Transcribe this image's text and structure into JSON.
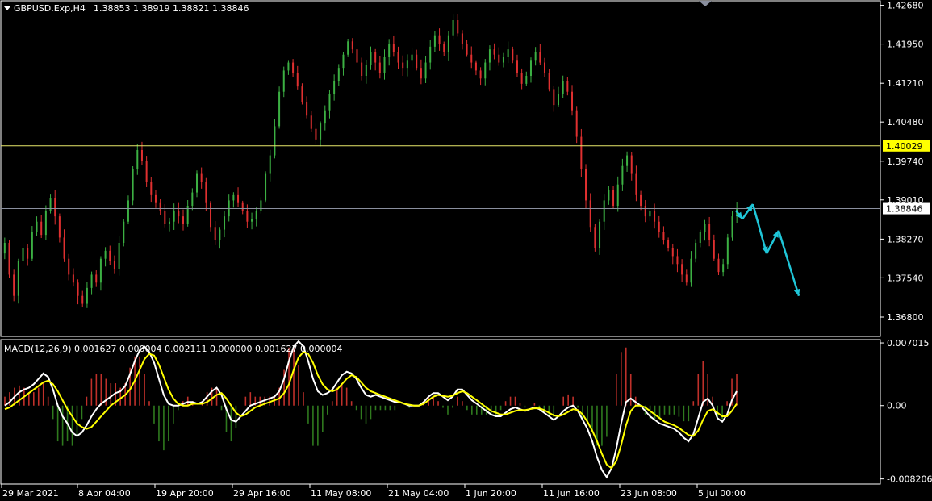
{
  "header": {
    "symbol": "GBPUSD.Exp,H4",
    "ohlc": "1.38853 1.38919 1.38821 1.38846"
  },
  "macd_header": "MACD(12,26,9) 0.001627 0.000004 0.002111 0.000000 0.001627 0.000004",
  "colors": {
    "background": "#000000",
    "frame": "#ffffff",
    "bull_candle": "#3cb043",
    "bear_candle": "#e03030",
    "level_line": "#e8e86a",
    "current_line": "#8a8f9e",
    "level_tag_bg": "#ffff00",
    "forecast_arrow": "#1fc6d8",
    "macd_line": "#ffffff",
    "signal_line": "#ffff00",
    "hist_pos": "#c0302a",
    "hist_neg": "#2f7a1e"
  },
  "chart_data": [
    {
      "type": "candlestick",
      "title": "GBPUSD.Exp,H4",
      "ylim": [
        1.3645,
        1.4275
      ],
      "y_ticks": [
        "1.42680",
        "1.41950",
        "1.41210",
        "1.40480",
        "1.39740",
        "1.39010",
        "1.38270",
        "1.37540",
        "1.36800"
      ],
      "tick_values": [
        1.4268,
        1.4195,
        1.4121,
        1.4048,
        1.3974,
        1.3901,
        1.3827,
        1.3754,
        1.368
      ],
      "level_line": {
        "value": 1.40029,
        "label": "1.40029"
      },
      "current_price": {
        "value": 1.38846,
        "label": "1.38846"
      },
      "closes": [
        1.382,
        1.376,
        1.372,
        1.3785,
        1.381,
        1.379,
        1.384,
        1.386,
        1.3835,
        1.388,
        1.3905,
        1.387,
        1.383,
        1.379,
        1.376,
        1.3745,
        1.372,
        1.3705,
        1.3735,
        1.376,
        1.3745,
        1.379,
        1.3805,
        1.3785,
        1.377,
        1.382,
        1.386,
        1.39,
        1.396,
        1.3995,
        1.3975,
        1.3935,
        1.391,
        1.3895,
        1.388,
        1.3855,
        1.386,
        1.388,
        1.387,
        1.3855,
        1.389,
        1.3915,
        1.395,
        1.3935,
        1.3895,
        1.385,
        1.3825,
        1.3845,
        1.387,
        1.39,
        1.391,
        1.3895,
        1.388,
        1.386,
        1.3865,
        1.388,
        1.39,
        1.395,
        1.3985,
        1.404,
        1.4105,
        1.4145,
        1.416,
        1.414,
        1.4115,
        1.4085,
        1.406,
        1.4035,
        1.4015,
        1.4045,
        1.407,
        1.41,
        1.4125,
        1.415,
        1.4175,
        1.42,
        1.4185,
        1.416,
        1.4135,
        1.4155,
        1.418,
        1.416,
        1.414,
        1.417,
        1.4195,
        1.418,
        1.416,
        1.415,
        1.4165,
        1.4175,
        1.415,
        1.413,
        1.416,
        1.419,
        1.421,
        1.4195,
        1.418,
        1.421,
        1.424,
        1.4215,
        1.4195,
        1.4175,
        1.416,
        1.4145,
        1.413,
        1.416,
        1.4185,
        1.4175,
        1.416,
        1.417,
        1.4185,
        1.4165,
        1.414,
        1.412,
        1.4135,
        1.4165,
        1.418,
        1.416,
        1.414,
        1.411,
        1.408,
        1.41,
        1.4125,
        1.4105,
        1.407,
        1.402,
        1.396,
        1.39,
        1.385,
        1.381,
        1.386,
        1.39,
        1.392,
        1.389,
        1.393,
        1.3965,
        1.3985,
        1.395,
        1.391,
        1.389,
        1.387,
        1.388,
        1.386,
        1.384,
        1.3825,
        1.381,
        1.3795,
        1.378,
        1.376,
        1.3745,
        1.379,
        1.382,
        1.384,
        1.3855,
        1.3825,
        1.379,
        1.3765,
        1.378,
        1.383,
        1.387,
        1.3885
      ],
      "forecast": {
        "points": [
          [
            1.3881,
            1.388
          ],
          [
            1.3865,
            1.3868
          ],
          [
            1.3893,
            1.3894
          ],
          [
            1.38,
            1.3799
          ],
          [
            1.3843,
            1.3843
          ],
          [
            1.372,
            1.372
          ]
        ]
      }
    },
    {
      "type": "macd",
      "title": "MACD(12,26,9)",
      "ylim": [
        -0.0086,
        0.0072
      ],
      "y_ticks": [
        "0.007015",
        "0.00",
        "-0.008206"
      ],
      "tick_values": [
        0.007015,
        0.0,
        -0.008206
      ],
      "macd_values": [
        0.0,
        0.0004,
        0.001,
        0.0015,
        0.0018,
        0.002,
        0.0024,
        0.003,
        0.0036,
        0.0032,
        0.0018,
        0.0,
        -0.0012,
        -0.002,
        -0.003,
        -0.0034,
        -0.003,
        -0.0022,
        -0.0012,
        -0.0004,
        0.0002,
        0.0006,
        0.001,
        0.0014,
        0.0016,
        0.0022,
        0.0035,
        0.005,
        0.0062,
        0.0066,
        0.006,
        0.0048,
        0.003,
        0.0012,
        0.0002,
        0.0,
        0.0,
        0.0002,
        0.0004,
        0.0004,
        0.0002,
        0.0004,
        0.001,
        0.0016,
        0.002,
        0.0012,
        -0.0004,
        -0.0016,
        -0.0018,
        -0.0012,
        -0.0006,
        0.0,
        0.0002,
        0.0004,
        0.0006,
        0.0008,
        0.001,
        0.0016,
        0.003,
        0.005,
        0.0066,
        0.0072,
        0.0066,
        0.005,
        0.003,
        0.0016,
        0.0012,
        0.0014,
        0.0018,
        0.0026,
        0.0034,
        0.0038,
        0.0036,
        0.003,
        0.002,
        0.0012,
        0.001,
        0.0012,
        0.001,
        0.0008,
        0.0006,
        0.0004,
        0.0004,
        0.0002,
        0.0,
        0.0,
        0.0,
        0.0004,
        0.001,
        0.0014,
        0.0014,
        0.001,
        0.0006,
        0.001,
        0.0018,
        0.0018,
        0.0012,
        0.0006,
        0.0002,
        -0.0002,
        -0.0006,
        -0.001,
        -0.0012,
        -0.0012,
        -0.0008,
        -0.0004,
        -0.0002,
        -0.0004,
        -0.0006,
        -0.0004,
        -0.0002,
        -0.0004,
        -0.0008,
        -0.0012,
        -0.0016,
        -0.0012,
        -0.0006,
        -0.0002,
        0.0,
        -0.0006,
        -0.0016,
        -0.0026,
        -0.004,
        -0.0058,
        -0.0072,
        -0.008,
        -0.007,
        -0.0048,
        -0.002,
        0.0004,
        0.0008,
        0.0004,
        0.0,
        -0.0006,
        -0.0012,
        -0.0016,
        -0.002,
        -0.0022,
        -0.0024,
        -0.0026,
        -0.003,
        -0.0036,
        -0.004,
        -0.0032,
        -0.0014,
        0.0004,
        0.0008,
        0.0,
        -0.0014,
        -0.0018,
        -0.001,
        0.0006,
        0.0016
      ],
      "signal_values": [
        -0.0004,
        -0.0002,
        0.0002,
        0.0006,
        0.001,
        0.0014,
        0.0018,
        0.0022,
        0.0026,
        0.0028,
        0.0024,
        0.0016,
        0.0006,
        -0.0004,
        -0.0012,
        -0.002,
        -0.0024,
        -0.0026,
        -0.0024,
        -0.0018,
        -0.0012,
        -0.0006,
        0.0,
        0.0004,
        0.0008,
        0.0012,
        0.0018,
        0.0028,
        0.004,
        0.0052,
        0.0058,
        0.0056,
        0.0046,
        0.0032,
        0.0018,
        0.0008,
        0.0002,
        0.0,
        0.0,
        0.0002,
        0.0002,
        0.0002,
        0.0004,
        0.0008,
        0.0012,
        0.0014,
        0.0008,
        0.0,
        -0.0008,
        -0.0012,
        -0.001,
        -0.0006,
        -0.0002,
        0.0,
        0.0002,
        0.0004,
        0.0006,
        0.0008,
        0.0014,
        0.0024,
        0.004,
        0.0054,
        0.006,
        0.0058,
        0.0048,
        0.0034,
        0.0024,
        0.0018,
        0.0016,
        0.0018,
        0.0024,
        0.003,
        0.0034,
        0.0032,
        0.0026,
        0.002,
        0.0016,
        0.0014,
        0.0012,
        0.001,
        0.0008,
        0.0006,
        0.0004,
        0.0002,
        0.0001,
        0.0,
        0.0,
        0.0002,
        0.0006,
        0.001,
        0.0012,
        0.0011,
        0.001,
        0.0011,
        0.0014,
        0.0016,
        0.0014,
        0.001,
        0.0006,
        0.0002,
        -0.0002,
        -0.0006,
        -0.0008,
        -0.001,
        -0.001,
        -0.0008,
        -0.0006,
        -0.0005,
        -0.0005,
        -0.0004,
        -0.0003,
        -0.0003,
        -0.0005,
        -0.0008,
        -0.0011,
        -0.0012,
        -0.001,
        -0.0007,
        -0.0004,
        -0.0005,
        -0.001,
        -0.0018,
        -0.0028,
        -0.004,
        -0.0054,
        -0.0066,
        -0.007,
        -0.0062,
        -0.0044,
        -0.0022,
        -0.0006,
        0.0,
        0.0,
        -0.0002,
        -0.0006,
        -0.001,
        -0.0014,
        -0.0018,
        -0.002,
        -0.0022,
        -0.0025,
        -0.0029,
        -0.0033,
        -0.0034,
        -0.0028,
        -0.0016,
        -0.0006,
        -0.0004,
        -0.0008,
        -0.0012,
        -0.0012,
        -0.0006,
        0.0002
      ]
    }
  ],
  "x_ticks": [
    "29 Mar 2021",
    "8 Apr 04:00",
    "19 Apr 20:00",
    "29 Apr 16:00",
    "11 May 08:00",
    "21 May 04:00",
    "1 Jun 20:00",
    "11 Jun 16:00",
    "23 Jun 08:00",
    "5 Jul 00:00"
  ]
}
